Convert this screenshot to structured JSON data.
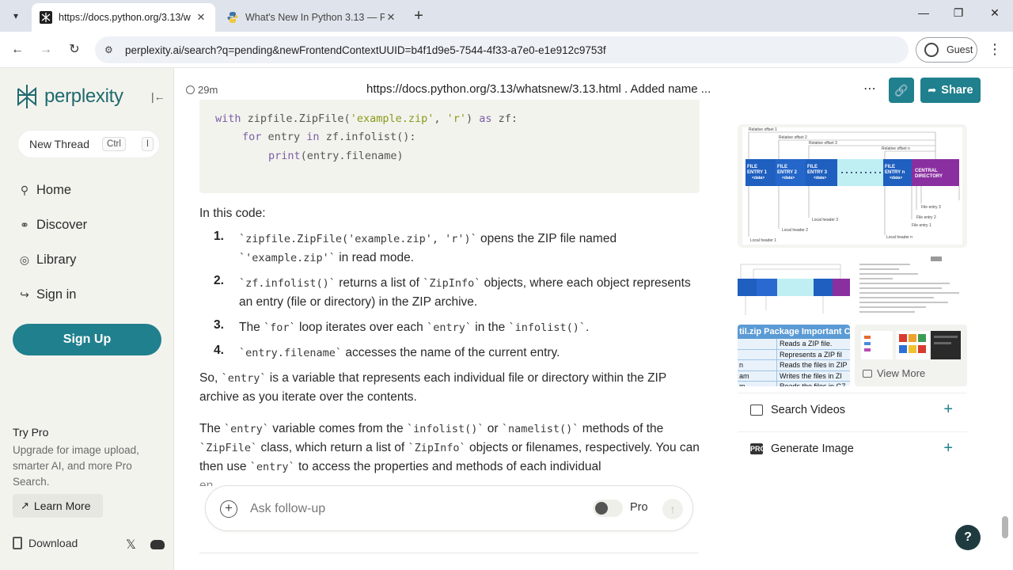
{
  "browser": {
    "tabs": [
      {
        "title": "https://docs.python.org/3.13/w",
        "active": true
      },
      {
        "title": "What's New In Python 3.13 — P",
        "active": false
      }
    ],
    "url": "perplexity.ai/search?q=pending&newFrontendContextUUID=b4f1d9e5-7544-4f33-a7e0-e1e912c9753f",
    "profile_label": "Guest"
  },
  "sidebar": {
    "brand": "perplexity",
    "new_thread": "New Thread",
    "shortcut_ctrl": "Ctrl",
    "shortcut_key": "I",
    "nav": [
      {
        "label": "Home",
        "icon": "search-icon"
      },
      {
        "label": "Discover",
        "icon": "globe-icon"
      },
      {
        "label": "Library",
        "icon": "library-icon"
      },
      {
        "label": "Sign in",
        "icon": "sign-in-icon"
      }
    ],
    "signup": "Sign Up",
    "try_pro_title": "Try Pro",
    "try_pro_desc": "Upgrade for image upload, smarter AI, and more Pro Search.",
    "learn_more": "Learn More",
    "download": "Download"
  },
  "header": {
    "time": "29m",
    "title": "https://docs.python.org/3.13/whatsnew/3.13.html . Added name ...",
    "share": "Share"
  },
  "code": {
    "line1_kw": "with",
    "line1_a": " zipfile.ZipFile(",
    "line1_s1": "'example.zip'",
    "line1_b": ", ",
    "line1_s2": "'r'",
    "line1_c": ") ",
    "line1_kw2": "as",
    "line1_d": " zf:",
    "line2_kw": "for",
    "line2_a": " entry ",
    "line2_kw2": "in",
    "line2_b": " zf.infolist():",
    "line3_fn": "print",
    "line3_a": "(entry.filename)"
  },
  "content": {
    "intro": "In this code:",
    "items": [
      {
        "num": "1.",
        "code1": "`zipfile.ZipFile('example.zip', 'r')`",
        "text1": " opens the ZIP file named ",
        "code2": "`'example.zip'`",
        "text2": " in read mode."
      },
      {
        "num": "2.",
        "code1": "`zf.infolist()`",
        "text1": " returns a list of ",
        "code2": "`ZipInfo`",
        "text2": " objects, where each object represents an entry (file or directory) in the ZIP archive."
      },
      {
        "num": "3.",
        "t0": "The ",
        "code1": "`for`",
        "text1": " loop iterates over each ",
        "code2": "`entry`",
        "text2": " in the ",
        "code3": "`infolist()`",
        "text3": "."
      },
      {
        "num": "4.",
        "code1": "`entry.filename`",
        "text1": " accesses the name of the current entry."
      }
    ],
    "para1_a": "So, ",
    "para1_code": "`entry`",
    "para1_b": " is a variable that represents each individual file or directory within the ZIP archive as you iterate over the contents.",
    "para2_a": "The ",
    "para2_c1": "`entry`",
    "para2_b": " variable comes from the ",
    "para2_c2": "`infolist()`",
    "para2_c": " or ",
    "para2_c3": "`namelist()`",
    "para2_d": " methods of the ",
    "para2_c4": "`ZipFile`",
    "para2_e": " class, which return a list of ",
    "para2_c5": "`ZipInfo`",
    "para2_f": " objects or filenames, respectively. You can then use ",
    "para2_c6": "`entry`",
    "para2_g": " to access the properties and methods of each individual",
    "para2_cut": "en"
  },
  "ask": {
    "placeholder": "Ask follow-up",
    "pro_label": "Pro"
  },
  "right": {
    "diagram_labels": {
      "ro1": "Relative offset 1",
      "ro2": "Relative offset 2",
      "ro3": "Relative offset 3",
      "ron": "Relative offset n",
      "fe1a": "FILE",
      "fe1b": "ENTRY 1",
      "fe2b": "ENTRY 2",
      "fe3b": "ENTRY 3",
      "fenb": "ENTRY n",
      "data": "<data>",
      "cd1": "CENTRAL",
      "cd2": "DIRECTORY",
      "lh1": "Local header 1",
      "lh2": "Local header 2",
      "lh3": "Local header 3",
      "lhn": "Local header n",
      "fentry3": "File entry 3",
      "fentry2": "File entry 2",
      "fentry1": "File entry 1"
    },
    "zip_table_title": "til.zip Package Important C",
    "zip_table_rows": [
      {
        "k": "",
        "v": "Reads a ZIP file."
      },
      {
        "k": "",
        "v": "Represents a ZIP fil"
      },
      {
        "k": "n",
        "v": "Reads the files in ZIP"
      },
      {
        "k": "am",
        "v": "Writes the files in ZI"
      },
      {
        "k": "m",
        "v": "Reads the files in G7"
      }
    ],
    "view_more": "View More",
    "search_videos": "Search Videos",
    "generate_image": "Generate Image",
    "pro_badge": "PRO"
  },
  "colors": {
    "accent": "#20808d",
    "sidebar_bg": "#f3f3ee",
    "file_entry_blue": "#1f5fbf",
    "central_directory_purple": "#8a2fa0"
  }
}
